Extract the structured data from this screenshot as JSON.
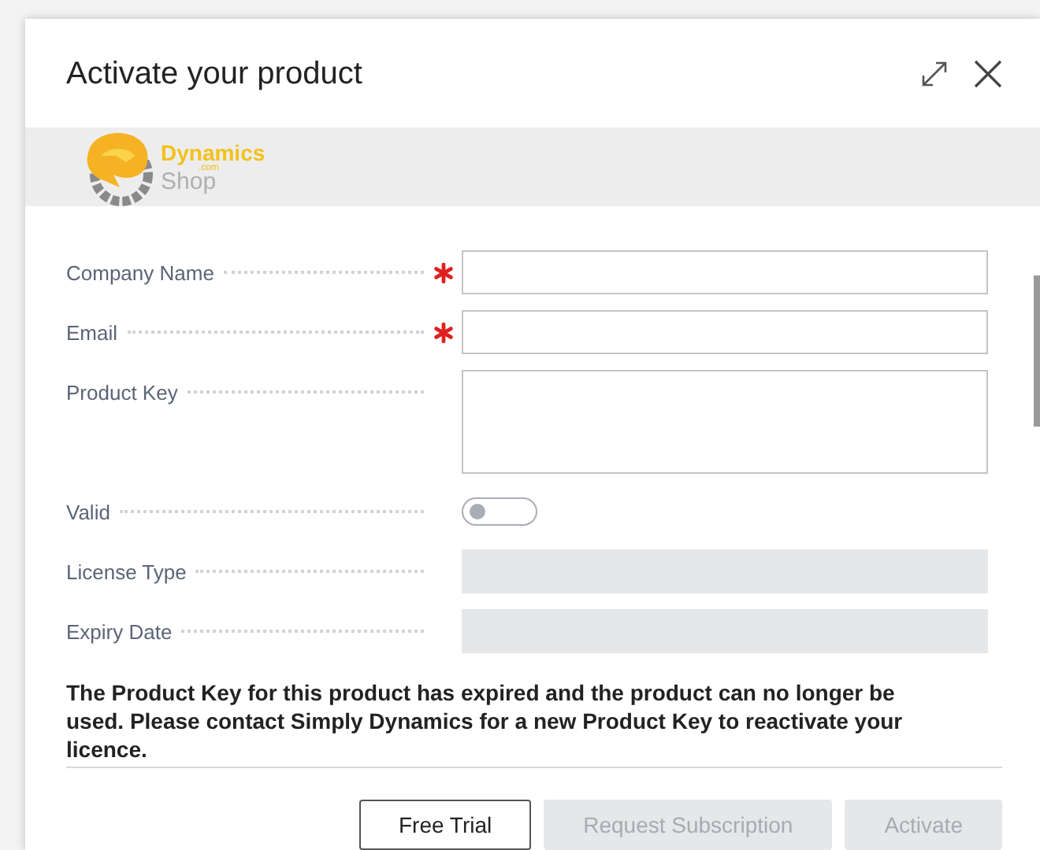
{
  "dialog": {
    "title": "Activate your product"
  },
  "logo": {
    "name": "Dynamics",
    "suffix": ".com",
    "subname": "Shop"
  },
  "fields": [
    {
      "kind": "text",
      "label": "Company Name",
      "required": true
    },
    {
      "kind": "text",
      "label": "Email",
      "required": true
    },
    {
      "kind": "textarea",
      "label": "Product Key",
      "required": false
    },
    {
      "kind": "toggle",
      "label": "Valid",
      "required": false,
      "on": false
    },
    {
      "kind": "readonly",
      "label": "License Type",
      "required": false
    },
    {
      "kind": "readonly",
      "label": "Expiry Date",
      "required": false
    }
  ],
  "message": "The Product Key for this product has expired and the product can no longer be used. Please contact Simply Dynamics for a new Product Key to reactivate your licence.",
  "buttons": [
    {
      "label": "Free Trial",
      "disabled": false
    },
    {
      "label": "Request Subscription",
      "disabled": true
    },
    {
      "label": "Activate",
      "disabled": true
    }
  ]
}
